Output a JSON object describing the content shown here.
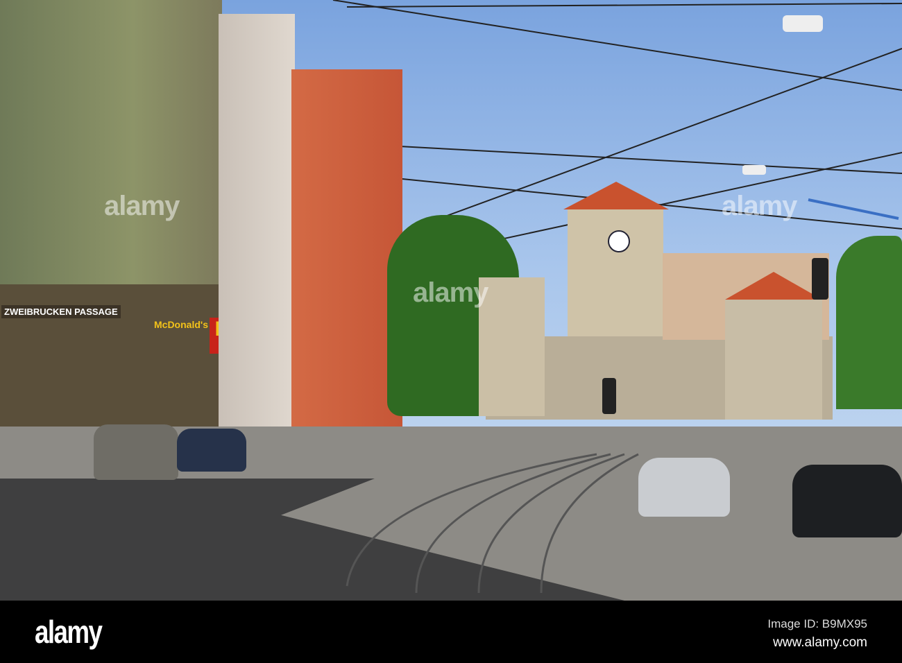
{
  "photo": {
    "signs": {
      "passage": "ZWEIBRUCKEN PASSAGE",
      "restaurant": "McDonald's"
    },
    "watermark": "alamy"
  },
  "footer": {
    "logo": "alamy",
    "image_id": "Image ID: B9MX95",
    "url": "www.alamy.com"
  }
}
